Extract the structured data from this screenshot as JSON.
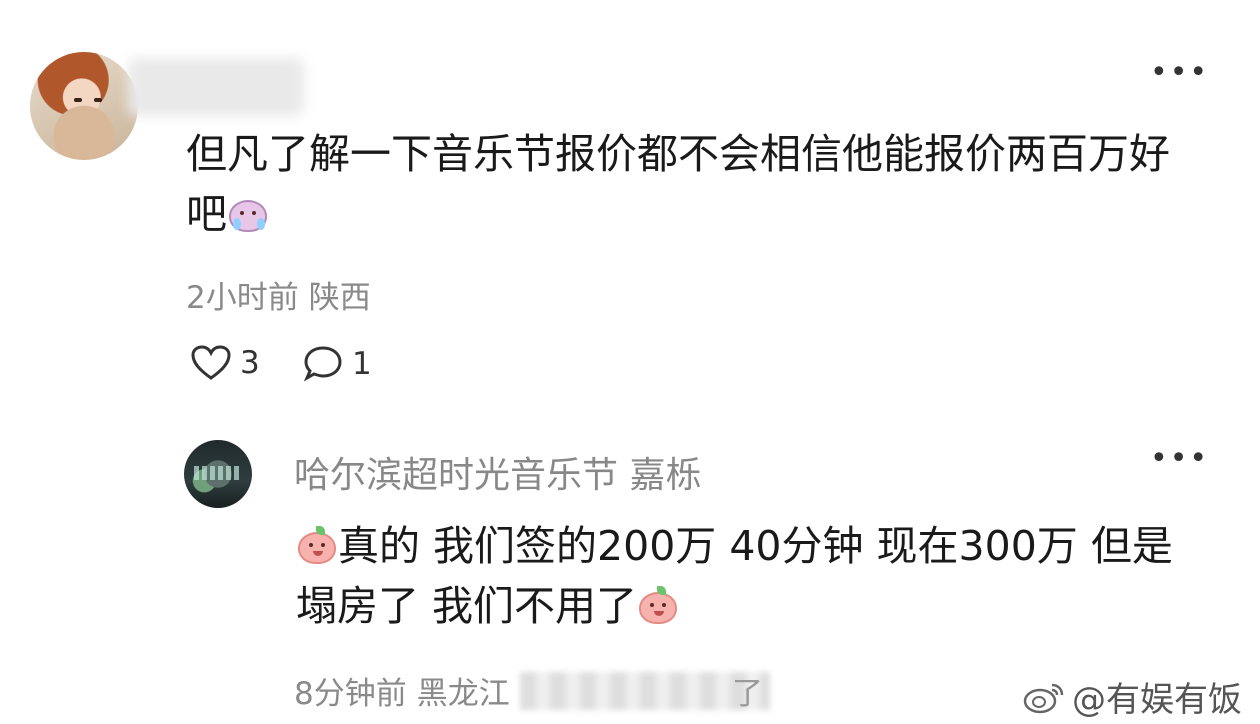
{
  "main_comment": {
    "text": "但凡了解一下音乐节报价都不会相信他能报价两百万好吧",
    "time": "2小时前",
    "location": "陕西",
    "like_count": "3",
    "reply_count": "1"
  },
  "reply": {
    "author": "哈尔滨超时光音乐节 嘉栎",
    "text": "真的 我们签的200万 40分钟 现在300万 但是塌房了 我们不用了",
    "time": "8分钟前",
    "location_visible": "黑龙江",
    "trailing": "了"
  },
  "watermark": {
    "text": "@有娱有饭"
  },
  "icons": {
    "more": "more-dots-icon",
    "like": "heart-icon",
    "comment": "comment-bubble-icon",
    "emoji": "peach-emoji-icon",
    "weibo": "weibo-logo-icon"
  }
}
